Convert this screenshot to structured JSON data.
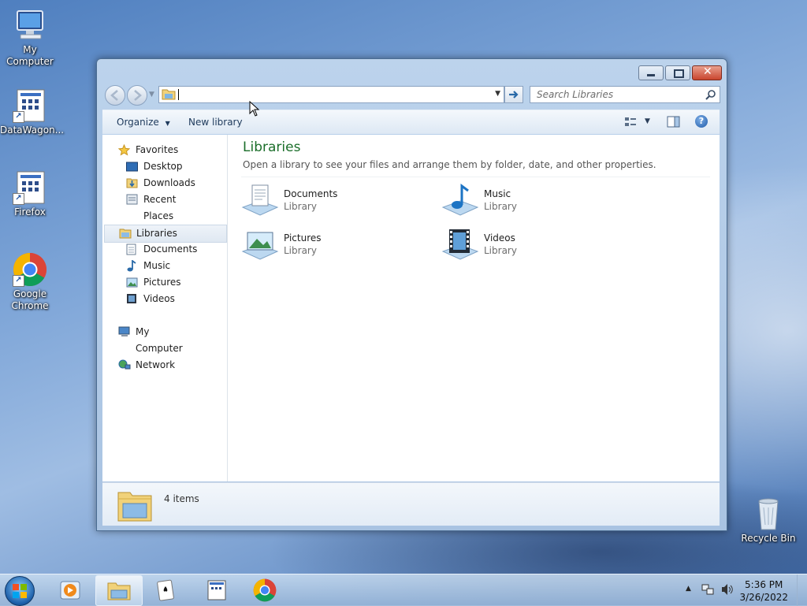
{
  "desktop": {
    "icons": [
      {
        "label": "My Computer",
        "icon": "computer-icon"
      },
      {
        "label": "DataWagon...",
        "icon": "app-window-icon"
      },
      {
        "label": "Firefox",
        "icon": "app-window-icon"
      },
      {
        "label": "Google Chrome",
        "icon": "chrome-icon"
      },
      {
        "label": "Recycle Bin",
        "icon": "recycle-bin-icon"
      }
    ]
  },
  "window": {
    "address_value": "",
    "search_placeholder": "Search Libraries",
    "toolbar": {
      "organize": "Organize",
      "new_library": "New library"
    },
    "nav": {
      "favorites": "Favorites",
      "desktop": "Desktop",
      "downloads": "Downloads",
      "recent_places": "Recent Places",
      "libraries": "Libraries",
      "documents": "Documents",
      "music": "Music",
      "pictures": "Pictures",
      "videos": "Videos",
      "my_computer": "My Computer",
      "network": "Network"
    },
    "main": {
      "title": "Libraries",
      "subtitle": "Open a library to see your files and arrange them by folder, date, and other properties.",
      "items": [
        {
          "name": "Documents",
          "type": "Library",
          "icon": "documents-library-icon"
        },
        {
          "name": "Music",
          "type": "Library",
          "icon": "music-library-icon"
        },
        {
          "name": "Pictures",
          "type": "Library",
          "icon": "pictures-library-icon"
        },
        {
          "name": "Videos",
          "type": "Library",
          "icon": "videos-library-icon"
        }
      ]
    },
    "status": {
      "count": "4 items"
    }
  },
  "taskbar": {
    "time": "5:36 PM",
    "date": "3/26/2022"
  },
  "colors": {
    "accent_title": "#1b6e2a",
    "taskbar": "#a9c3e2"
  }
}
